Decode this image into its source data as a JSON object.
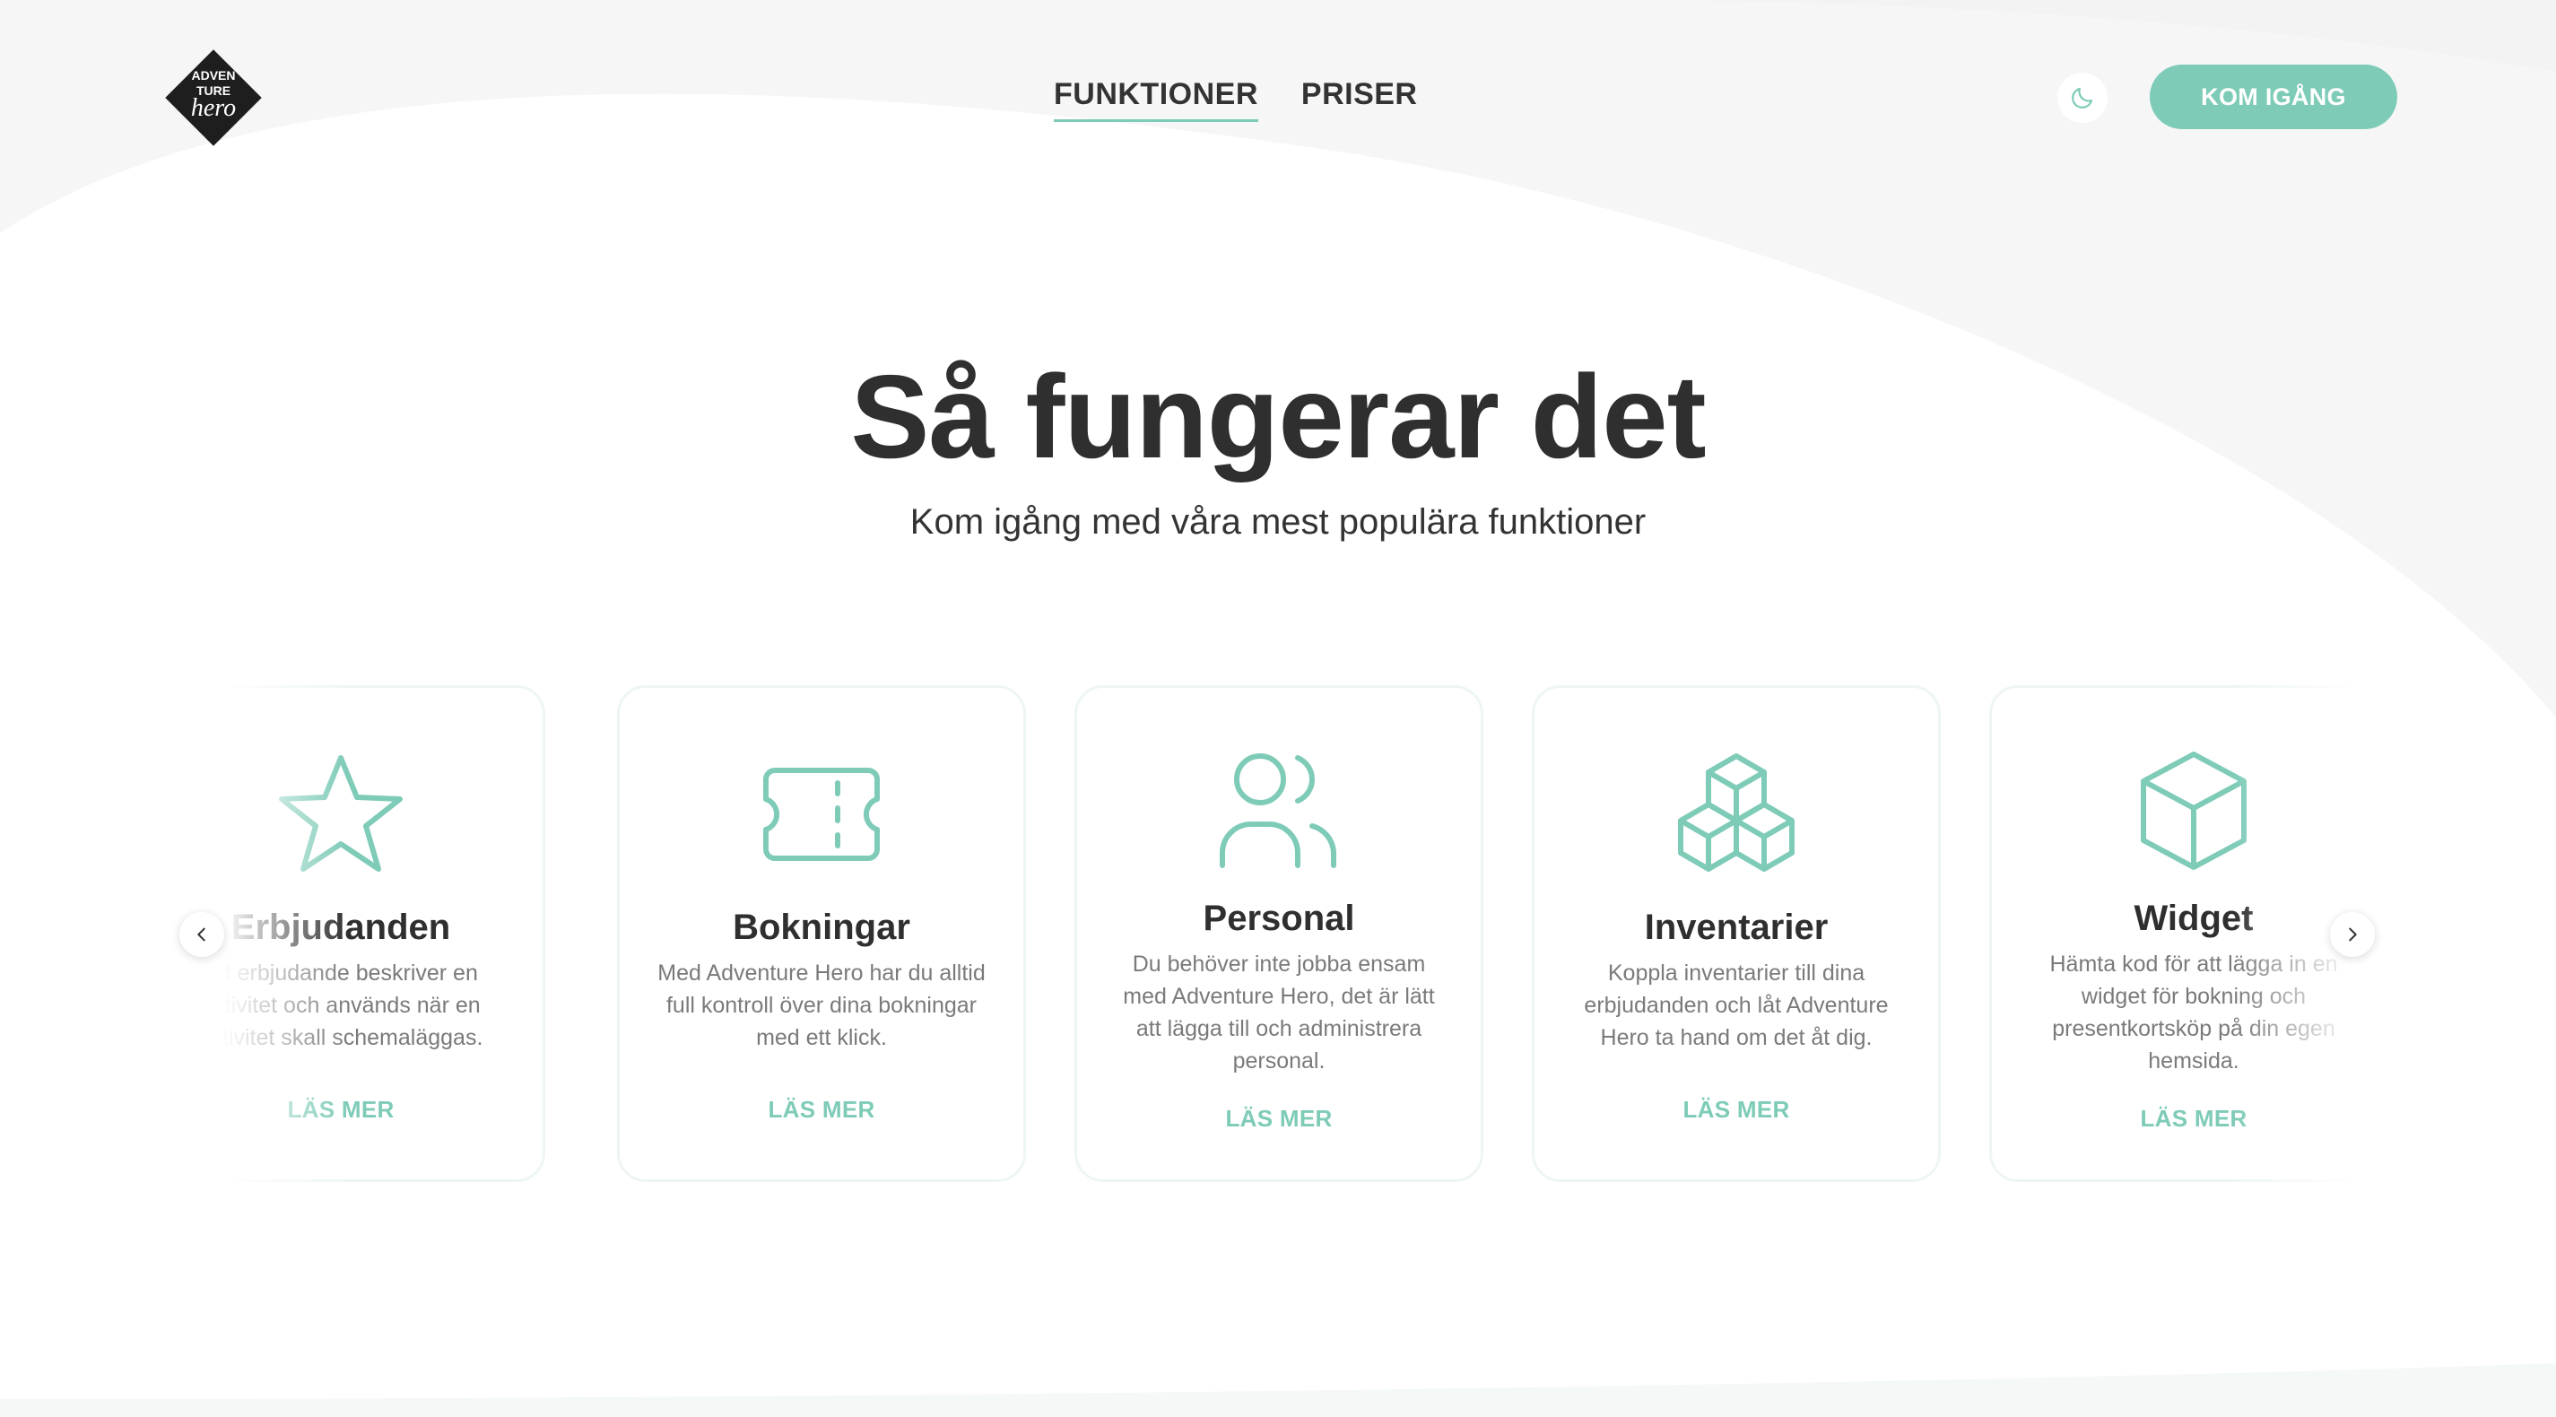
{
  "brand": {
    "logo_text": "ADVENTURE hero",
    "accent_color": "#7ecbb8"
  },
  "nav": {
    "items": [
      {
        "label": "FUNKTIONER",
        "active": true
      },
      {
        "label": "PRISER",
        "active": false
      }
    ]
  },
  "header": {
    "theme_toggle_icon": "moon-icon",
    "cta_label": "KOM IGÅNG"
  },
  "hero": {
    "title": "Så fungerar det",
    "subtitle": "Kom igång med våra mest populära funktioner"
  },
  "cards": [
    {
      "icon": "star-icon",
      "title": "Erbjudanden",
      "description": "Ett erbjudande beskriver en aktivitet och används när en aktivitet skall schemaläggas.",
      "link": "LÄS MER"
    },
    {
      "icon": "ticket-icon",
      "title": "Bokningar",
      "description": "Med Adventure Hero har du alltid full kontroll över dina bokningar med ett klick.",
      "link": "LÄS MER"
    },
    {
      "icon": "users-icon",
      "title": "Personal",
      "description": "Du behöver inte jobba ensam med Adventure Hero, det är lätt att lägga till och administrera personal.",
      "link": "LÄS MER"
    },
    {
      "icon": "boxes-icon",
      "title": "Inventarier",
      "description": "Koppla inventarier till dina erbjudanden och låt Adventure Hero ta hand om det åt dig.",
      "link": "LÄS MER"
    },
    {
      "icon": "cube-icon",
      "title": "Widget",
      "description": "Hämta kod för att lägga in en widget för bokning och presentkortsköp på din egen hemsida.",
      "link": "LÄS MER"
    }
  ],
  "carousel": {
    "prev_icon": "chevron-left-icon",
    "next_icon": "chevron-right-icon"
  }
}
